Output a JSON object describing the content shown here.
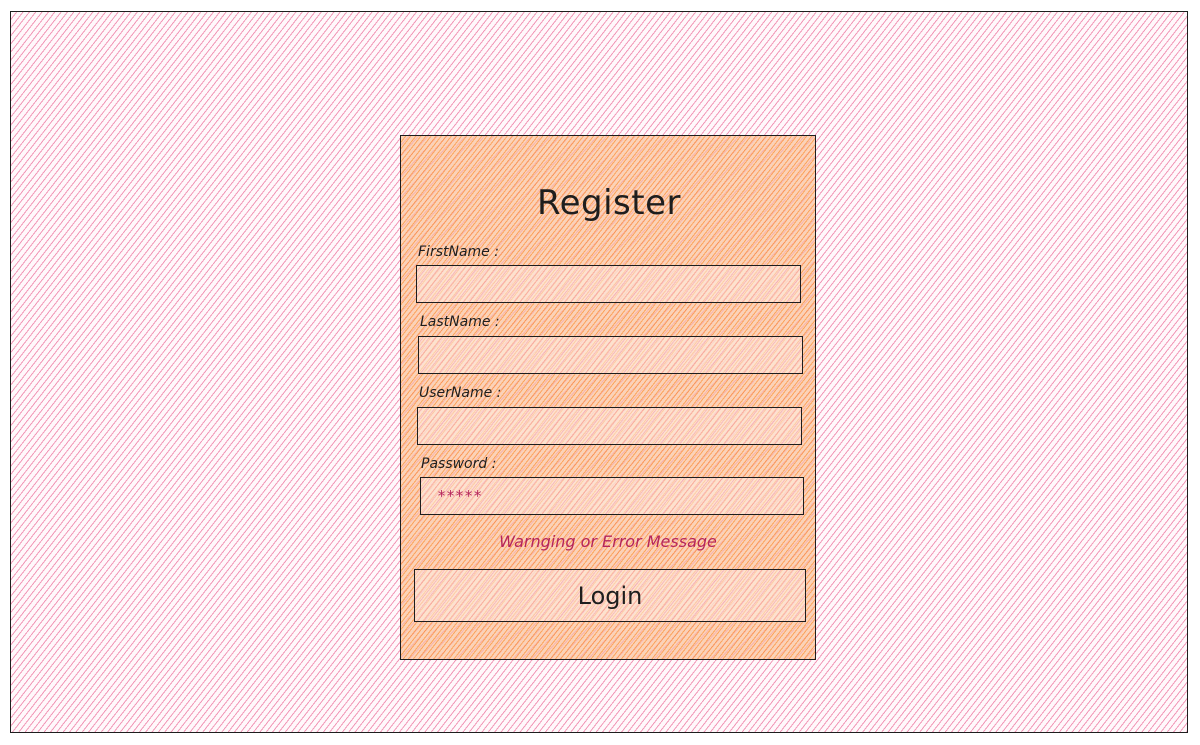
{
  "form": {
    "title": "Register",
    "fields": [
      {
        "label": "FirstName :",
        "value": "",
        "placeholder": ""
      },
      {
        "label": "LastName :",
        "value": "",
        "placeholder": ""
      },
      {
        "label": "UserName :",
        "value": "",
        "placeholder": ""
      },
      {
        "label": "Password :",
        "value": "*****",
        "placeholder": ""
      }
    ],
    "message": "Warnging or Error Message",
    "submit_label": "Login"
  },
  "colors": {
    "background_hatch": "#e64980",
    "card_hatch": "#fd7e14",
    "message": "#b5255b",
    "stroke": "#1e1e1e"
  }
}
